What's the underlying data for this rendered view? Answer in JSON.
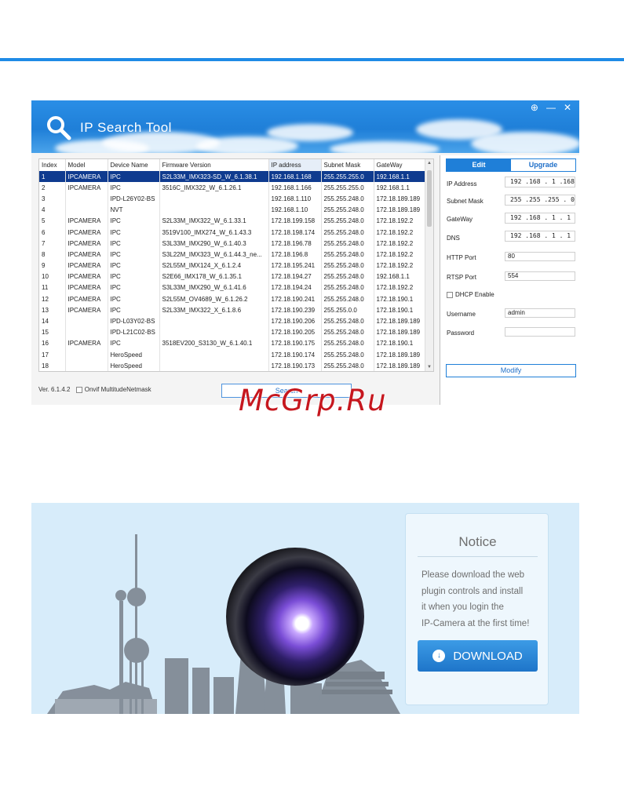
{
  "app": {
    "title": "IP Search Tool",
    "controls": [
      "⊕",
      "—",
      "✕"
    ]
  },
  "table": {
    "columns": [
      "Index",
      "Model",
      "Device Name",
      "Firmware Version",
      "IP address",
      "Subnet Mask",
      "GateWay"
    ],
    "rows": [
      [
        "1",
        "IPCAMERA",
        "IPC",
        "S2L33M_IMX323-SD_W_6.1.38.1",
        "192.168.1.168",
        "255.255.255.0",
        "192.168.1.1"
      ],
      [
        "2",
        "IPCAMERA",
        "IPC",
        "3516C_IMX322_W_6.1.26.1",
        "192.168.1.166",
        "255.255.255.0",
        "192.168.1.1"
      ],
      [
        "3",
        "",
        "IPD-L26Y02-BS",
        "",
        "192.168.1.110",
        "255.255.248.0",
        "172.18.189.189"
      ],
      [
        "4",
        "",
        "NVT",
        "",
        "192.168.1.10",
        "255.255.248.0",
        "172.18.189.189"
      ],
      [
        "5",
        "IPCAMERA",
        "IPC",
        "S2L33M_IMX322_W_6.1.33.1",
        "172.18.199.158",
        "255.255.248.0",
        "172.18.192.2"
      ],
      [
        "6",
        "IPCAMERA",
        "IPC",
        "3519V100_IMX274_W_6.1.43.3",
        "172.18.198.174",
        "255.255.248.0",
        "172.18.192.2"
      ],
      [
        "7",
        "IPCAMERA",
        "IPC",
        "S3L33M_IMX290_W_6.1.40.3",
        "172.18.196.78",
        "255.255.248.0",
        "172.18.192.2"
      ],
      [
        "8",
        "IPCAMERA",
        "IPC",
        "S3L22M_IMX323_W_6.1.44.3_ne...",
        "172.18.196.8",
        "255.255.248.0",
        "172.18.192.2"
      ],
      [
        "9",
        "IPCAMERA",
        "IPC",
        "S2L55M_IMX124_X_6.1.2.4",
        "172.18.195.241",
        "255.255.248.0",
        "172.18.192.2"
      ],
      [
        "10",
        "IPCAMERA",
        "IPC",
        "S2E66_IMX178_W_6.1.35.1",
        "172.18.194.27",
        "255.255.248.0",
        "192.168.1.1"
      ],
      [
        "11",
        "IPCAMERA",
        "IPC",
        "S3L33M_IMX290_W_6.1.41.6",
        "172.18.194.24",
        "255.255.248.0",
        "172.18.192.2"
      ],
      [
        "12",
        "IPCAMERA",
        "IPC",
        "S2L55M_OV4689_W_6.1.26.2",
        "172.18.190.241",
        "255.255.248.0",
        "172.18.190.1"
      ],
      [
        "13",
        "IPCAMERA",
        "IPC",
        "S2L33M_IMX322_X_6.1.8.6",
        "172.18.190.239",
        "255.255.0.0",
        "172.18.190.1"
      ],
      [
        "14",
        "",
        "IPD-L03Y02-BS",
        "",
        "172.18.190.206",
        "255.255.248.0",
        "172.18.189.189"
      ],
      [
        "15",
        "",
        "IPD-L21C02-BS",
        "",
        "172.18.190.205",
        "255.255.248.0",
        "172.18.189.189"
      ],
      [
        "16",
        "IPCAMERA",
        "IPC",
        "3518EV200_S3130_W_6.1.40.1",
        "172.18.190.175",
        "255.255.248.0",
        "172.18.190.1"
      ],
      [
        "17",
        "",
        "HeroSpeed",
        "",
        "172.18.190.174",
        "255.255.248.0",
        "172.18.189.189"
      ],
      [
        "18",
        "",
        "HeroSpeed",
        "",
        "172.18.190.173",
        "255.255.248.0",
        "172.18.189.189"
      ]
    ]
  },
  "footer": {
    "version": "Ver. 6.1.4.2",
    "onvif_label": "Onvif MultitudeNetmask",
    "search_label": "Search"
  },
  "panel": {
    "tab_edit": "Edit",
    "tab_upgrade": "Upgrade",
    "ip_label": "IP Address",
    "ip_value": "192 .168 . 1 .168",
    "mask_label": "Subnet Mask",
    "mask_value": "255 .255 .255 . 0",
    "gateway_label": "GateWay",
    "gateway_value": "192 .168 . 1 . 1",
    "dns_label": "DNS",
    "dns_value": "192 .168 . 1 . 1",
    "http_label": "HTTP Port",
    "http_value": "80",
    "rtsp_label": "RTSP Port",
    "rtsp_value": "554",
    "dhcp_label": "DHCP Enable",
    "username_label": "Username",
    "username_value": "admin",
    "password_label": "Password",
    "password_value": "",
    "modify_label": "Modify"
  },
  "notice": {
    "title": "Notice",
    "lines": [
      "Please download the web",
      "plugin controls and install",
      "it when you login the",
      "IP-Camera at the first time!"
    ],
    "download_label": "DOWNLOAD"
  },
  "watermark": "McGrp.Ru",
  "colors": {
    "accent": "#1f7fd8",
    "selected_row": "#0f3b8f",
    "watermark": "#c6171e"
  }
}
